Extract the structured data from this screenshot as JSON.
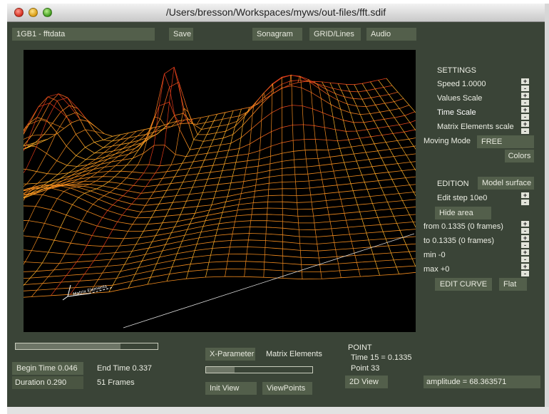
{
  "window": {
    "title": "/Users/bresson/Workspaces/myws/out-files/fft.sdif"
  },
  "top": {
    "stream_selector": "1GB1 - fftdata",
    "save_label": "Save",
    "sonagram_label": "Sonagram",
    "grid_label": "GRID/Lines",
    "audio_label": "Audio"
  },
  "settings": {
    "heading": "SETTINGS",
    "speed": "Speed 1.0000",
    "values_scale": "Values Scale",
    "time_scale": "Time Scale",
    "matrix_scale": "Matrix Elements scale",
    "moving_mode_label": "Moving Mode",
    "moving_mode_value": "FREE",
    "colors_label": "Colors"
  },
  "edition": {
    "heading": "EDITION",
    "model_surface_label": "Model surface",
    "edit_step": "Edit step 10e0",
    "hide_area_label": "Hide area",
    "from": "from 0.1335 (0 frames)",
    "to": "to 0.1335 (0 frames)",
    "min": "min -0",
    "max": "max +0",
    "edit_curve_label": "EDIT CURVE",
    "flat_label": "Flat"
  },
  "stepper": {
    "plus": "+",
    "minus": "-"
  },
  "view": {
    "axis_label": "Matrix Elements",
    "colors": {
      "peak": "#e23a1a",
      "mid": "#f08a1e",
      "low": "#ffb52a"
    }
  },
  "bottom": {
    "time_progress": 0.74,
    "begin_time": "Begin Time 0.046",
    "end_time": "End Time 0.337",
    "duration": "Duration 0.290",
    "frames": "51 Frames",
    "x_param_label": "X-Parameter",
    "x_param_value": "Matrix Elements",
    "slider_progress": 0.27,
    "init_view_label": "Init View",
    "viewpoints_label": "ViewPoints",
    "point_heading": "POINT",
    "point_time": "Time 15 = 0.1335",
    "point_index": "Point 33",
    "view_2d_label": "2D View",
    "amplitude": "amplitude = 68.363571"
  }
}
